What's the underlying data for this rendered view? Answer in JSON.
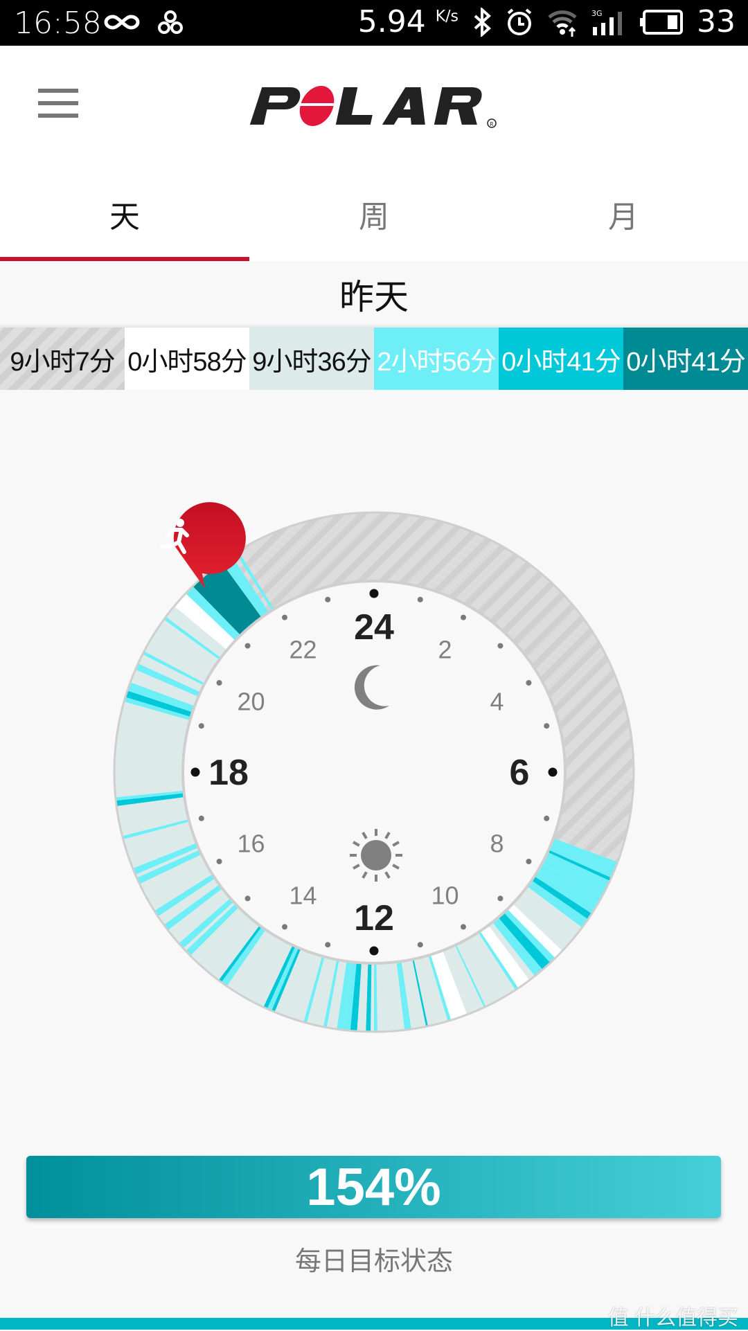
{
  "status_bar": {
    "time": "16:58",
    "left_icons": [
      "infinity-icon",
      "trefoil-icon"
    ],
    "net_speed": "5.94",
    "net_speed_unit": "K/s",
    "right_icons": [
      "bluetooth-icon",
      "alarm-icon",
      "wifi-icon",
      "signal-3g-icon",
      "battery-icon"
    ],
    "battery": "33"
  },
  "app_bar": {
    "menu_icon": "hamburger-menu-icon",
    "logo_text": "POLAR"
  },
  "tabs": [
    {
      "label": "天",
      "active": true
    },
    {
      "label": "周",
      "active": false
    },
    {
      "label": "月",
      "active": false
    }
  ],
  "day_header": "昨天",
  "activity_breakdown": [
    {
      "label": "9小时7分",
      "level": "rest",
      "color": "#d4d4d4",
      "text_color": "#111111"
    },
    {
      "label": "0小时58分",
      "level": "sitting",
      "color": "#ffffff",
      "text_color": "#111111"
    },
    {
      "label": "9小时36分",
      "level": "low",
      "color": "#dceaea",
      "text_color": "#111111"
    },
    {
      "label": "2小时56分",
      "level": "medium",
      "color": "#6eeef6",
      "text_color": "#ffffff"
    },
    {
      "label": "0小时41分",
      "level": "high",
      "color": "#00c8d8",
      "text_color": "#ffffff"
    },
    {
      "label": "0小时41分",
      "level": "max",
      "color": "#008a94",
      "text_color": "#ffffff"
    }
  ],
  "clock": {
    "major_labels": [
      {
        "hour": 24,
        "text": "24"
      },
      {
        "hour": 6,
        "text": "6"
      },
      {
        "hour": 12,
        "text": "12"
      },
      {
        "hour": 18,
        "text": "18"
      }
    ],
    "minor_labels": [
      {
        "hour": 2,
        "text": "2"
      },
      {
        "hour": 4,
        "text": "4"
      },
      {
        "hour": 8,
        "text": "8"
      },
      {
        "hour": 10,
        "text": "10"
      },
      {
        "hour": 14,
        "text": "14"
      },
      {
        "hour": 16,
        "text": "16"
      },
      {
        "hour": 20,
        "text": "20"
      },
      {
        "hour": 22,
        "text": "22"
      }
    ],
    "night_icon": "moon-icon",
    "day_icon": "sun-icon",
    "activity_marker_icon": "running-person-icon",
    "activity_marker_hour": 21.1,
    "segments": [
      {
        "start": 21.95,
        "end": 7.35,
        "level": "rest"
      },
      {
        "start": 7.35,
        "end": 7.6,
        "level": "medium"
      },
      {
        "start": 7.6,
        "end": 7.65,
        "level": "high"
      },
      {
        "start": 7.65,
        "end": 7.9,
        "level": "medium"
      },
      {
        "start": 7.9,
        "end": 8.2,
        "level": "medium"
      },
      {
        "start": 8.2,
        "end": 8.3,
        "level": "high"
      },
      {
        "start": 8.3,
        "end": 8.45,
        "level": "medium"
      },
      {
        "start": 8.45,
        "end": 8.9,
        "level": "low"
      },
      {
        "start": 8.9,
        "end": 9.05,
        "level": "sitting"
      },
      {
        "start": 9.05,
        "end": 9.15,
        "level": "medium"
      },
      {
        "start": 9.15,
        "end": 9.3,
        "level": "high"
      },
      {
        "start": 9.3,
        "end": 9.45,
        "level": "medium"
      },
      {
        "start": 9.45,
        "end": 9.55,
        "level": "low"
      },
      {
        "start": 9.55,
        "end": 9.75,
        "level": "sitting"
      },
      {
        "start": 9.75,
        "end": 9.8,
        "level": "medium"
      },
      {
        "start": 9.8,
        "end": 10.3,
        "level": "low"
      },
      {
        "start": 10.3,
        "end": 10.33,
        "level": "medium"
      },
      {
        "start": 10.33,
        "end": 10.6,
        "level": "low"
      },
      {
        "start": 10.6,
        "end": 10.85,
        "level": "sitting"
      },
      {
        "start": 10.85,
        "end": 10.9,
        "level": "medium"
      },
      {
        "start": 10.9,
        "end": 11.2,
        "level": "low"
      },
      {
        "start": 11.2,
        "end": 11.23,
        "level": "high"
      },
      {
        "start": 11.23,
        "end": 11.45,
        "level": "low"
      },
      {
        "start": 11.45,
        "end": 11.5,
        "level": "medium"
      },
      {
        "start": 11.5,
        "end": 11.55,
        "level": "medium"
      },
      {
        "start": 11.55,
        "end": 11.95,
        "level": "low"
      },
      {
        "start": 11.95,
        "end": 12.0,
        "level": "medium"
      },
      {
        "start": 12.0,
        "end": 12.05,
        "level": "low"
      },
      {
        "start": 12.05,
        "end": 12.12,
        "level": "high"
      },
      {
        "start": 12.12,
        "end": 12.25,
        "level": "low"
      },
      {
        "start": 12.25,
        "end": 12.35,
        "level": "high"
      },
      {
        "start": 12.35,
        "end": 12.45,
        "level": "medium"
      },
      {
        "start": 12.45,
        "end": 12.55,
        "level": "medium"
      },
      {
        "start": 12.55,
        "end": 12.7,
        "level": "low"
      },
      {
        "start": 12.7,
        "end": 12.75,
        "level": "medium"
      },
      {
        "start": 12.75,
        "end": 13.0,
        "level": "low"
      },
      {
        "start": 13.0,
        "end": 13.05,
        "level": "medium"
      },
      {
        "start": 13.05,
        "end": 13.5,
        "level": "low"
      },
      {
        "start": 13.5,
        "end": 13.55,
        "level": "high"
      },
      {
        "start": 13.55,
        "end": 13.62,
        "level": "medium"
      },
      {
        "start": 13.62,
        "end": 13.68,
        "level": "high"
      },
      {
        "start": 13.68,
        "end": 14.3,
        "level": "low"
      },
      {
        "start": 14.3,
        "end": 14.4,
        "level": "medium"
      },
      {
        "start": 14.4,
        "end": 14.45,
        "level": "high"
      },
      {
        "start": 14.45,
        "end": 15.0,
        "level": "low"
      },
      {
        "start": 15.0,
        "end": 15.1,
        "level": "medium"
      },
      {
        "start": 15.1,
        "end": 15.15,
        "level": "low"
      },
      {
        "start": 15.15,
        "end": 15.25,
        "level": "medium"
      },
      {
        "start": 15.25,
        "end": 15.5,
        "level": "low"
      },
      {
        "start": 15.5,
        "end": 15.6,
        "level": "medium"
      },
      {
        "start": 15.6,
        "end": 15.75,
        "level": "low"
      },
      {
        "start": 15.75,
        "end": 15.85,
        "level": "medium"
      },
      {
        "start": 15.85,
        "end": 16.3,
        "level": "low"
      },
      {
        "start": 16.3,
        "end": 16.4,
        "level": "medium"
      },
      {
        "start": 16.4,
        "end": 16.45,
        "level": "low"
      },
      {
        "start": 16.45,
        "end": 16.55,
        "level": "medium"
      },
      {
        "start": 16.55,
        "end": 17.0,
        "level": "low"
      },
      {
        "start": 17.0,
        "end": 17.05,
        "level": "medium"
      },
      {
        "start": 17.05,
        "end": 17.5,
        "level": "low"
      },
      {
        "start": 17.5,
        "end": 17.58,
        "level": "high"
      },
      {
        "start": 17.58,
        "end": 17.63,
        "level": "medium"
      },
      {
        "start": 17.63,
        "end": 19.05,
        "level": "low"
      },
      {
        "start": 19.05,
        "end": 19.12,
        "level": "medium"
      },
      {
        "start": 19.12,
        "end": 19.22,
        "level": "high"
      },
      {
        "start": 19.22,
        "end": 19.35,
        "level": "medium"
      },
      {
        "start": 19.35,
        "end": 19.55,
        "level": "low"
      },
      {
        "start": 19.55,
        "end": 19.65,
        "level": "medium"
      },
      {
        "start": 19.65,
        "end": 19.8,
        "level": "low"
      },
      {
        "start": 19.8,
        "end": 19.85,
        "level": "medium"
      },
      {
        "start": 19.85,
        "end": 20.4,
        "level": "low"
      },
      {
        "start": 20.4,
        "end": 20.45,
        "level": "medium"
      },
      {
        "start": 20.45,
        "end": 20.65,
        "level": "low"
      },
      {
        "start": 20.65,
        "end": 20.9,
        "level": "sitting"
      },
      {
        "start": 20.9,
        "end": 21.05,
        "level": "medium"
      },
      {
        "start": 21.05,
        "end": 21.6,
        "level": "max"
      },
      {
        "start": 21.6,
        "end": 21.78,
        "level": "medium"
      },
      {
        "start": 21.78,
        "end": 21.85,
        "level": "rest"
      },
      {
        "start": 21.85,
        "end": 21.9,
        "level": "medium"
      },
      {
        "start": 21.9,
        "end": 21.95,
        "level": "rest"
      }
    ]
  },
  "level_colors": {
    "rest": "#d6d6d6",
    "sitting": "#ffffff",
    "low": "#dceaea",
    "medium": "#6eeef6",
    "high": "#00c8d8",
    "max": "#008a94"
  },
  "goal": {
    "progress_percent": 154,
    "value_text": "154%",
    "label": "每日目标状态"
  },
  "watermark": "值 什么值得买"
}
